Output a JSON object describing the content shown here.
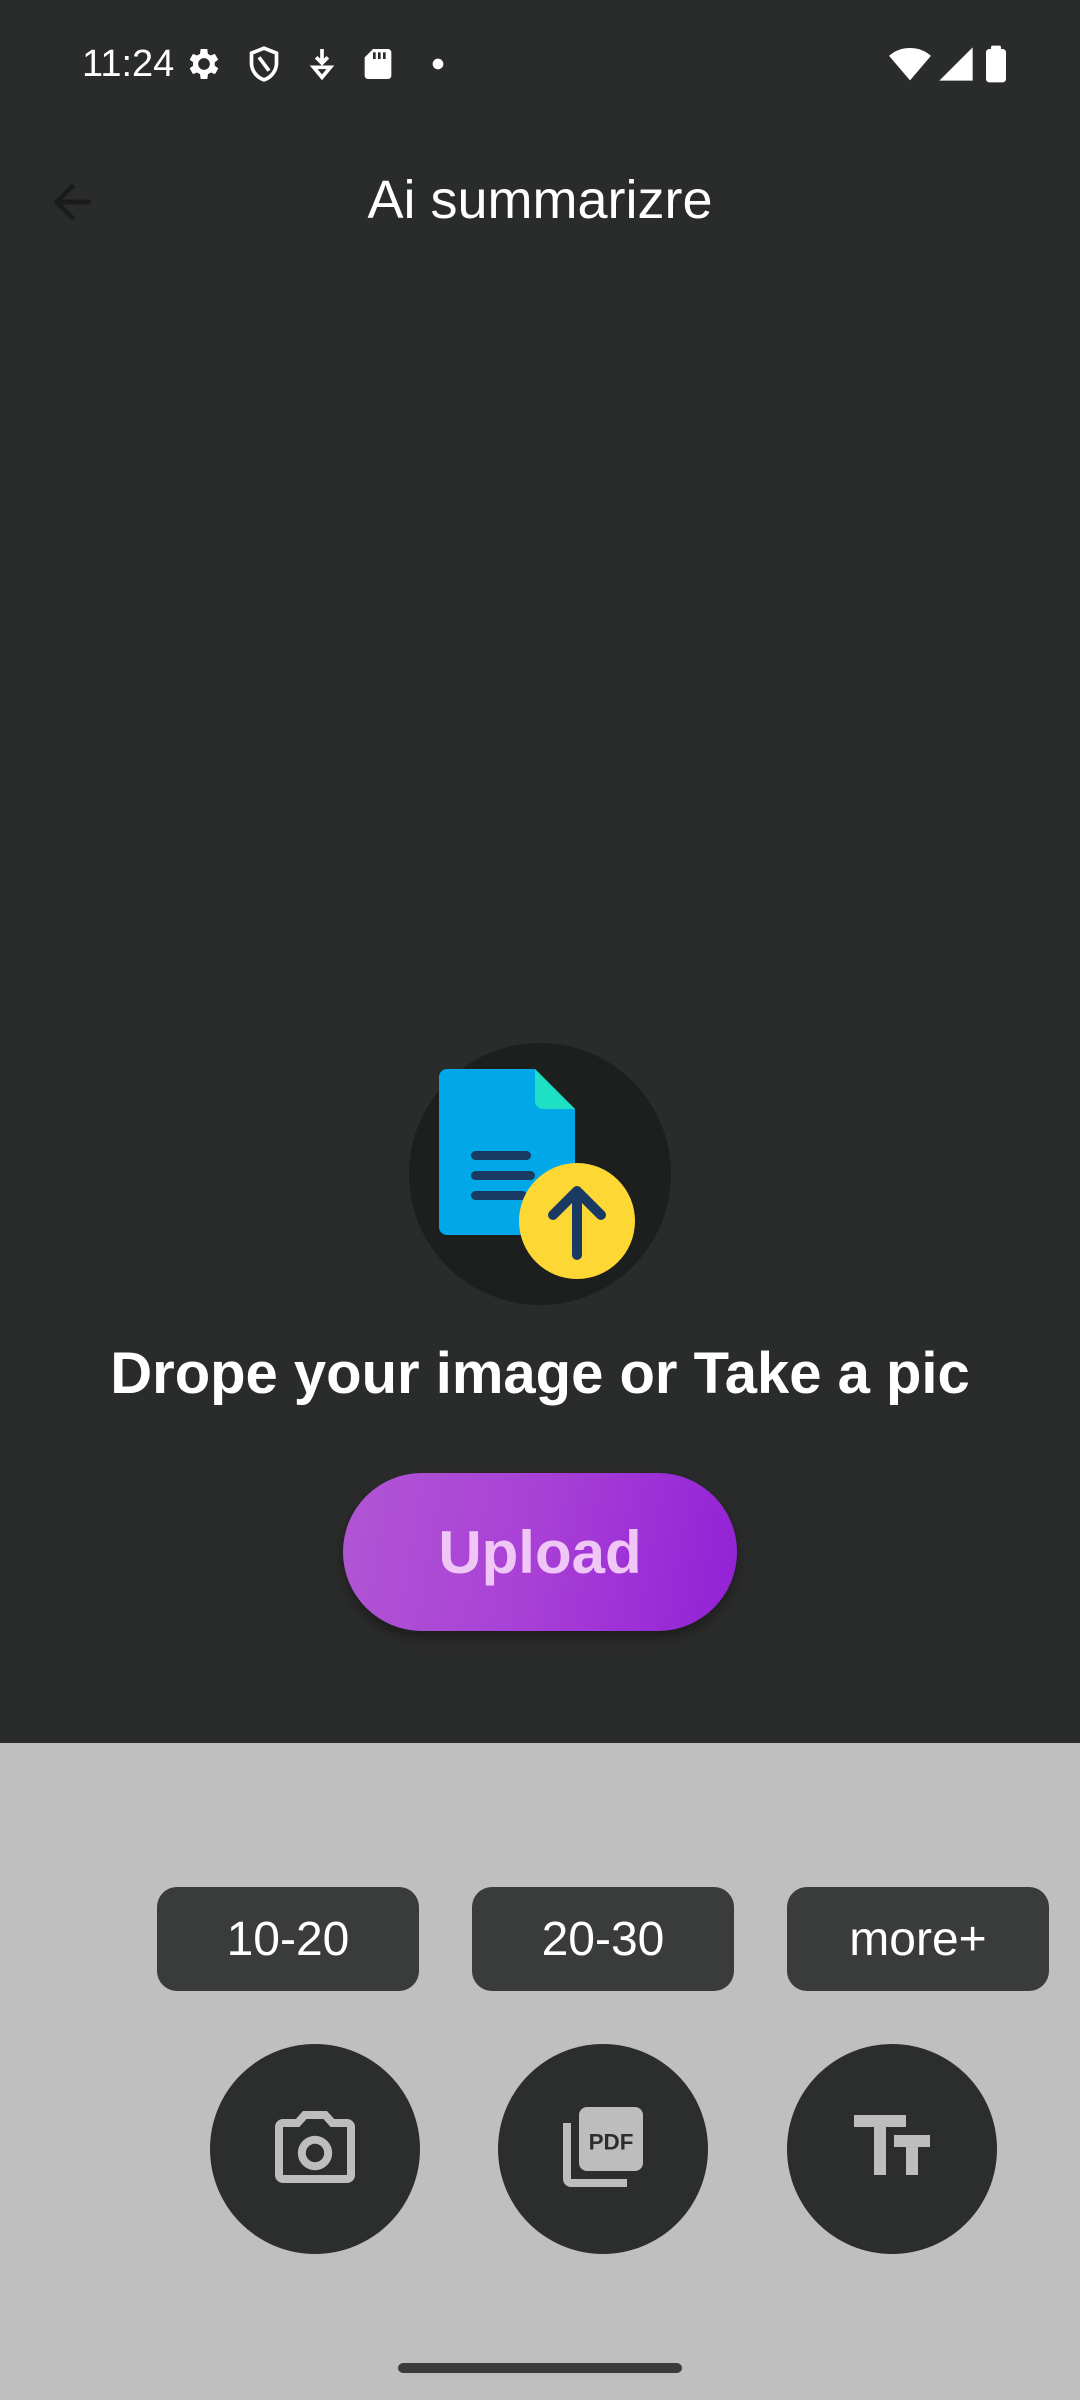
{
  "status_bar": {
    "time": "11:24",
    "icons_left": [
      "settings-icon",
      "shield-icon",
      "download-icon",
      "sd-card-icon",
      "dot-icon"
    ],
    "icons_right": [
      "wifi-icon",
      "cellular-signal-icon",
      "battery-icon"
    ]
  },
  "app_bar": {
    "title": "Ai summarizre",
    "back_icon": "arrow-back-icon"
  },
  "upload": {
    "illustration_icon": "file-upload-icon",
    "headline": "Drope your image or Take a pic",
    "button_label": "Upload"
  },
  "bottom_panel": {
    "ranges": [
      "10-20",
      "20-30",
      "more+"
    ],
    "input_modes": [
      {
        "icon": "camera-icon"
      },
      {
        "icon": "pdf-icon"
      },
      {
        "icon": "text-format-icon"
      }
    ]
  },
  "colors": {
    "background": "#2a2b2b",
    "panel": "#bfbfbf",
    "chip": "#3a3b3b",
    "upload_gradient_start": "#b156d4",
    "upload_gradient_end": "#9221d6",
    "upload_text": "#f0c6f7",
    "doc_blue": "#00a8e8",
    "doc_fold": "#1de0c4",
    "arrow_circle": "#fdd835"
  }
}
